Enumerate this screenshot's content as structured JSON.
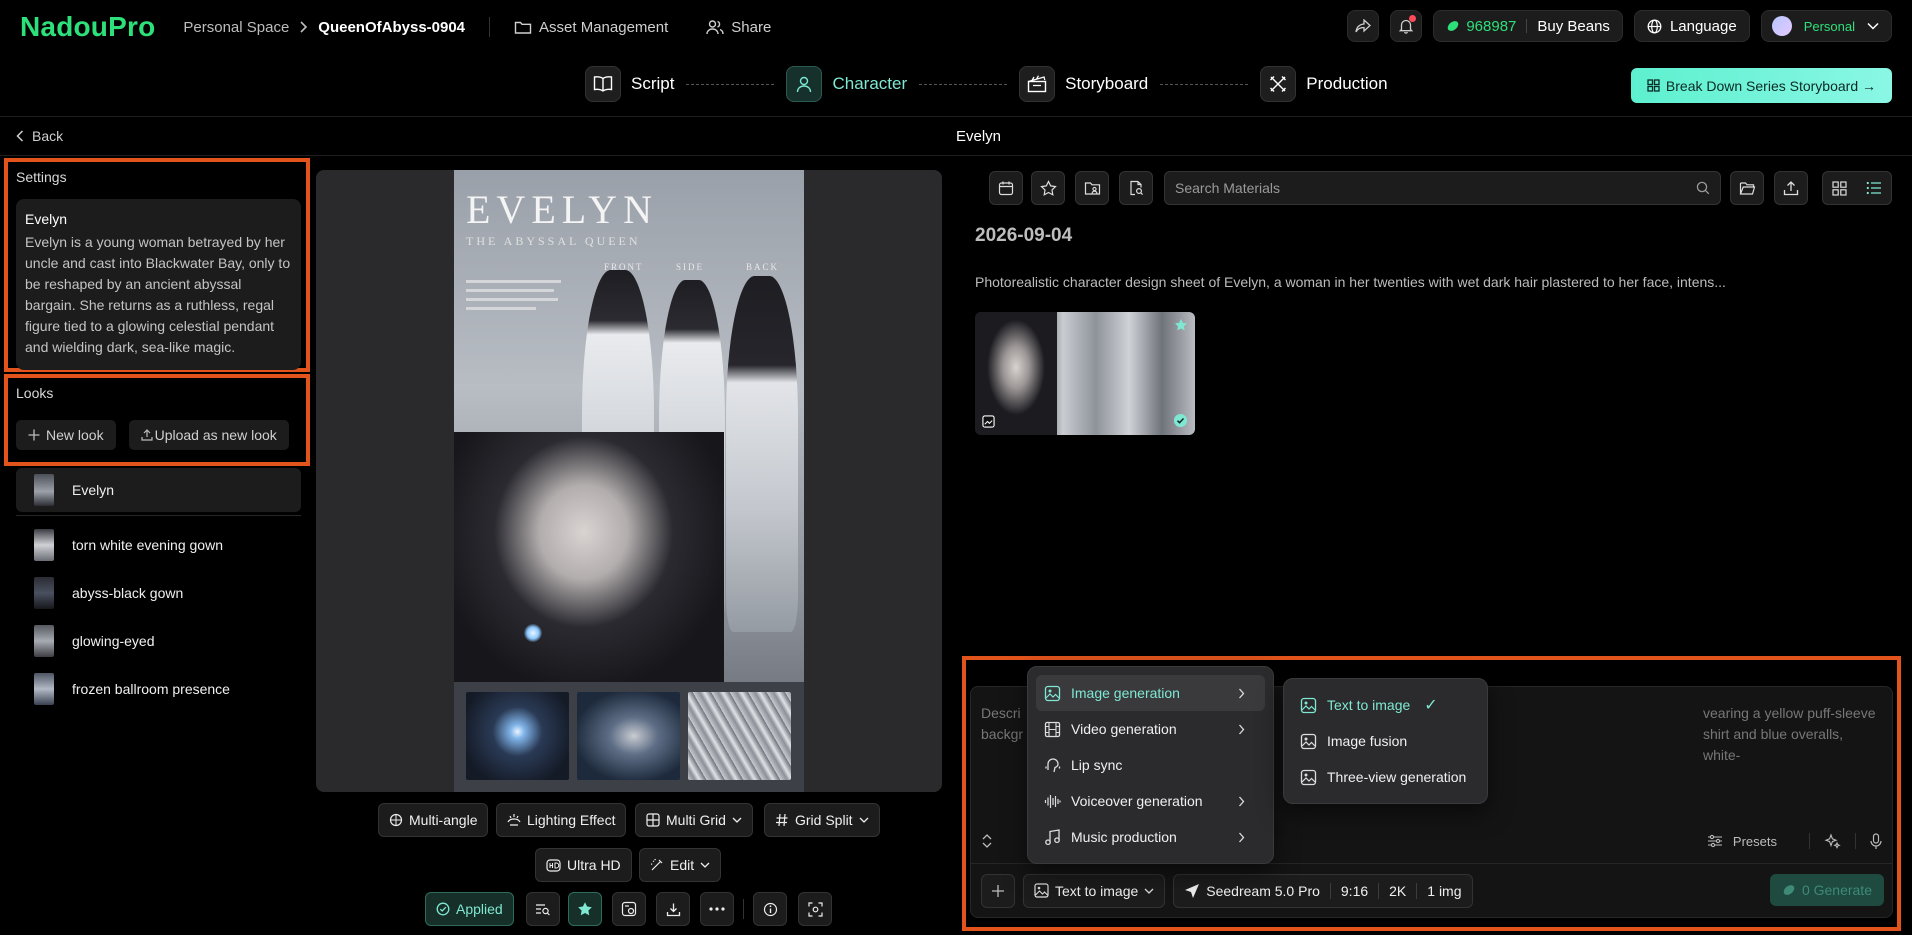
{
  "app": {
    "logo": "NadouPro",
    "breadcrumb_space": "Personal Space",
    "breadcrumb_project": "QueenOfAbyss-0904",
    "nav_asset": "Asset Management",
    "nav_share": "Share",
    "beans_count": "968987",
    "buy_beans": "Buy Beans",
    "language": "Language",
    "account": "Personal",
    "accent_color": "#2ee07a",
    "teal_color": "#7fe8d3",
    "highlight_color": "#e2541c"
  },
  "steps": [
    {
      "label": "Script",
      "icon": "book-icon"
    },
    {
      "label": "Character",
      "icon": "person-icon",
      "active": true
    },
    {
      "label": "Storyboard",
      "icon": "clapperboard-icon"
    },
    {
      "label": "Production",
      "icon": "tools-icon"
    }
  ],
  "breakdown_button": "Break Down Series Storyboard →",
  "subheader": {
    "back": "Back",
    "title": "Evelyn"
  },
  "settings": {
    "title": "Settings",
    "name": "Evelyn",
    "description": "Evelyn is a young woman betrayed by her uncle and cast into Blackwater Bay, only to be reshaped by an ancient abyssal bargain. She returns as a ruthless, regal figure tied to a glowing celestial pendant and wielding dark, sea-like magic."
  },
  "looks": {
    "title": "Looks",
    "new_look": "New look",
    "upload": "Upload as new look",
    "items": [
      "Evelyn",
      "torn white evening gown",
      "abyss-black gown",
      "glowing-eyed",
      "frozen ballroom presence"
    ]
  },
  "preview": {
    "sheet_title": "EVELYN",
    "sheet_subtitle": "THE ABYSSAL QUEEN",
    "label_front": "FRONT",
    "label_side": "SIDE",
    "label_back": "BACK"
  },
  "tools": {
    "multi_angle": "Multi-angle",
    "lighting": "Lighting Effect",
    "multi_grid": "Multi Grid",
    "grid_split": "Grid Split",
    "ultra_hd": "Ultra HD",
    "edit": "Edit",
    "applied": "Applied"
  },
  "materials": {
    "search_placeholder": "Search Materials",
    "date": "2026-09-04",
    "prompt": "Photorealistic character design sheet of Evelyn, a woman in her twenties with wet dark hair plastered to her face, intens..."
  },
  "composer": {
    "placeholder": "Descri… wearing a yellow puff-sleeve shirt and blue overalls, white-backgr…",
    "placeholder_left": "Descri",
    "placeholder_left2": "backgr",
    "placeholder_right": "vearing a yellow puff-sleeve shirt and blue overalls, white-",
    "presets": "Presets",
    "mode": "Text to image",
    "model": "Seedream 5.0 Pro",
    "ratio": "9:16",
    "resolution": "2K",
    "count": "1 img",
    "generate": "0 Generate"
  },
  "menu": {
    "items": [
      "Image generation",
      "Video generation",
      "Lip sync",
      "Voiceover generation",
      "Music production"
    ],
    "sub_items": [
      "Text to image",
      "Image fusion",
      "Three-view generation"
    ],
    "check": "✓"
  }
}
